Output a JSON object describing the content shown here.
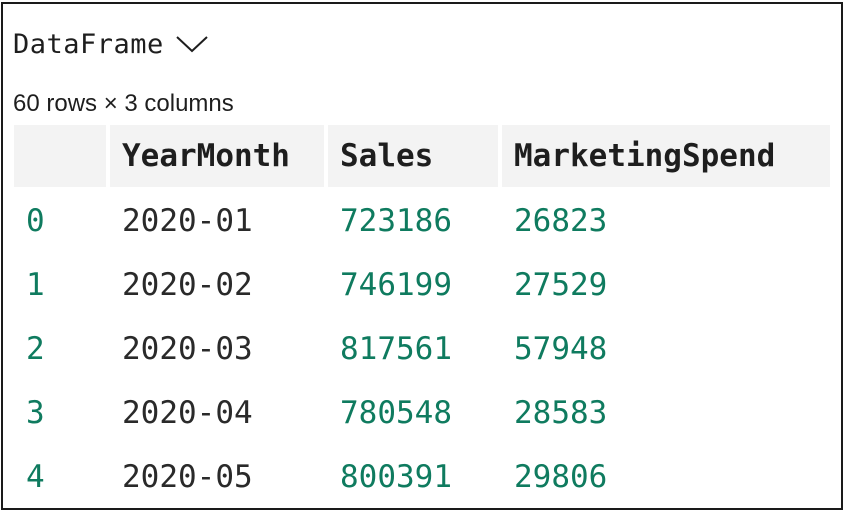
{
  "header": {
    "title": "DataFrame",
    "dropdown_icon": "chevron-down-icon"
  },
  "shape_text": "60 rows × 3 columns",
  "table": {
    "columns": [
      "",
      "YearMonth",
      "Sales",
      "MarketingSpend"
    ],
    "rows": [
      {
        "index": "0",
        "YearMonth": "2020-01",
        "Sales": "723186",
        "MarketingSpend": "26823"
      },
      {
        "index": "1",
        "YearMonth": "2020-02",
        "Sales": "746199",
        "MarketingSpend": "27529"
      },
      {
        "index": "2",
        "YearMonth": "2020-03",
        "Sales": "817561",
        "MarketingSpend": "57948"
      },
      {
        "index": "3",
        "YearMonth": "2020-04",
        "Sales": "780548",
        "MarketingSpend": "28583"
      },
      {
        "index": "4",
        "YearMonth": "2020-05",
        "Sales": "800391",
        "MarketingSpend": "29806"
      }
    ]
  },
  "colors": {
    "numeric": "#0f7b5f",
    "text": "#2a2a2a",
    "header_bg": "#f3f3f3",
    "border": "#1a1a1a"
  }
}
